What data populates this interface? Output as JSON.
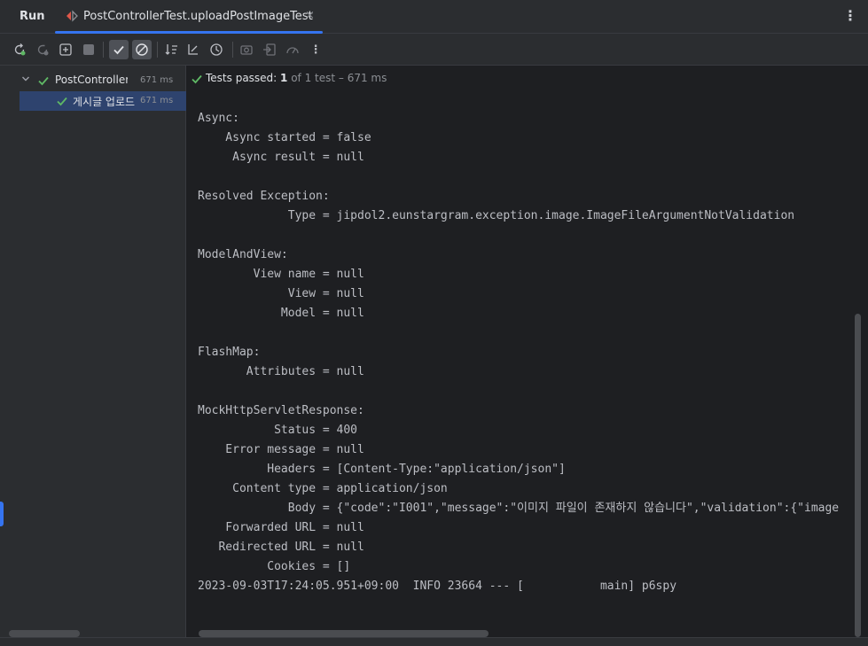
{
  "titlebar": {
    "run_label": "Run",
    "tab_title": "PostControllerTest.uploadPostImageTest",
    "close_glyph": "×",
    "more_glyph": "⋮"
  },
  "toolbar": {
    "icons": [
      "rerun-icon",
      "rerun-failed-icon",
      "toggle-auto-test-icon",
      "stop-icon",
      "show-passed-icon",
      "show-ignored-icon",
      "sort-alphabetically-icon",
      "sort-by-duration-icon",
      "test-history-icon",
      "screenshot-icon",
      "import-tests-icon",
      "coverage-icon",
      "more-icon"
    ]
  },
  "tree": {
    "root": {
      "name": "PostControllerTest",
      "time": "671 ms"
    },
    "child": {
      "name": "게시글 업로드",
      "time": "671 ms"
    }
  },
  "status": {
    "prefix": "Tests passed: ",
    "count": "1",
    "suffix": " of 1 test – 671 ms"
  },
  "console": {
    "lines": [
      "",
      "Async:",
      "    Async started = false",
      "     Async result = null",
      "",
      "Resolved Exception:",
      "             Type = jipdol2.eunstargram.exception.image.ImageFileArgumentNotValidation",
      "",
      "ModelAndView:",
      "        View name = null",
      "             View = null",
      "            Model = null",
      "",
      "FlashMap:",
      "       Attributes = null",
      "",
      "MockHttpServletResponse:",
      "           Status = 400",
      "    Error message = null",
      "          Headers = [Content-Type:\"application/json\"]",
      "     Content type = application/json",
      "             Body = {\"code\":\"I001\",\"message\":\"이미지 파일이 존재하지 않습니다\",\"validation\":{\"image",
      "    Forwarded URL = null",
      "   Redirected URL = null",
      "          Cookies = []",
      "2023-09-03T17:24:05.951+09:00  INFO 23664 --- [           main] p6spy"
    ]
  },
  "colors": {
    "accent": "#3574f0",
    "pass_green": "#5fb865",
    "selection": "#2e436e"
  }
}
